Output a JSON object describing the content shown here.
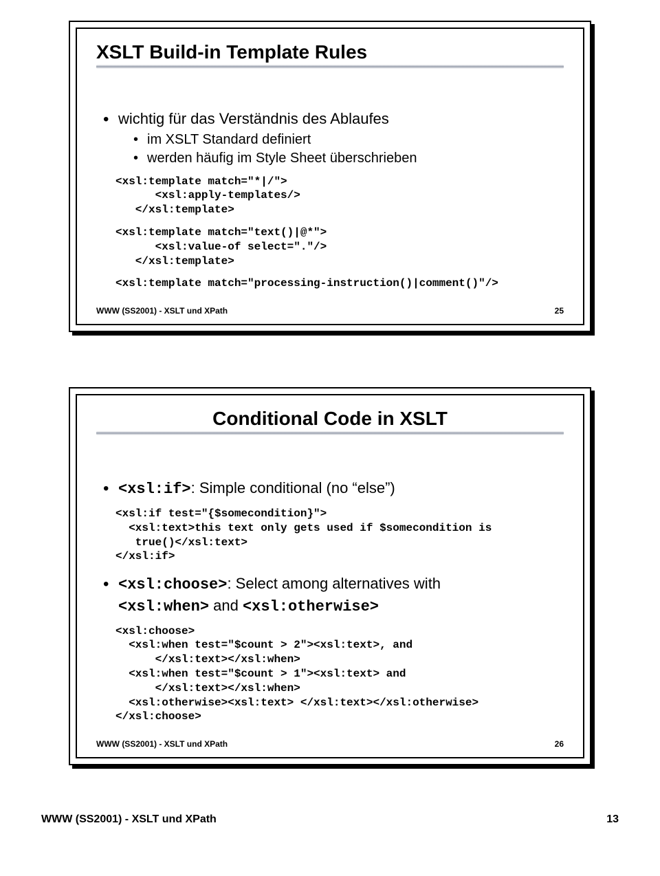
{
  "slide1": {
    "title": "XSLT Build-in Template Rules",
    "bullets": {
      "main": "wichtig für das Verständnis des Ablaufes",
      "sub1": "im XSLT Standard definiert",
      "sub2": "werden häufig im Style Sheet überschrieben"
    },
    "code1": "<xsl:template match=\"*|/\">\n      <xsl:apply-templates/>\n   </xsl:template>",
    "code2": "<xsl:template match=\"text()|@*\">\n      <xsl:value-of select=\".\"/>\n   </xsl:template>",
    "code3": "<xsl:template match=\"processing-instruction()|comment()\"/>",
    "footer": "WWW (SS2001) - XSLT und XPath",
    "page": "25"
  },
  "slide2": {
    "title": "Conditional Code in XSLT",
    "if_code": "<xsl:if>",
    "if_text": ": Simple conditional (no “else”)",
    "code1": "<xsl:if test=\"{$somecondition}\">\n  <xsl:text>this text only gets used if $somecondition is\n   true()</xsl:text>\n</xsl:if>",
    "choose_code": "<xsl:choose>",
    "choose_text_a": ": Select among alternatives with",
    "when_code": "<xsl:when>",
    "and_word": " and ",
    "otherwise_code": "<xsl:otherwise>",
    "code2": "<xsl:choose>\n  <xsl:when test=\"$count > 2\"><xsl:text>, and\n      </xsl:text></xsl:when>\n  <xsl:when test=\"$count > 1\"><xsl:text> and\n      </xsl:text></xsl:when>\n  <xsl:otherwise><xsl:text> </xsl:text></xsl:otherwise>\n</xsl:choose>",
    "footer": "WWW (SS2001) - XSLT und XPath",
    "page": "26"
  },
  "page_footer": {
    "left": "WWW (SS2001) - XSLT und XPath",
    "right": "13"
  }
}
